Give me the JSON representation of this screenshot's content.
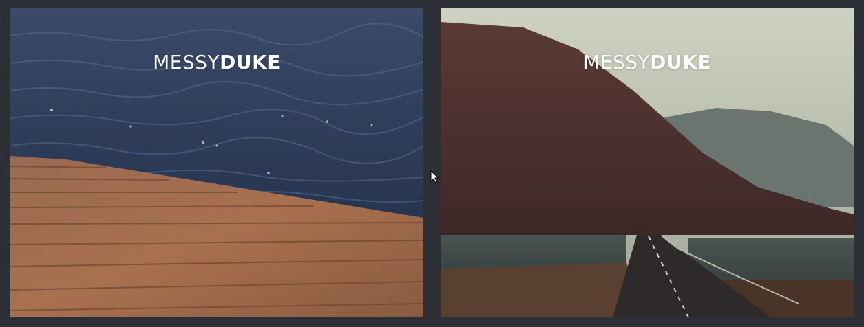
{
  "slides": [
    {
      "logo": {
        "light": "MESSY",
        "bold": "DUKE"
      },
      "scene": "water-and-wooden-dock"
    },
    {
      "logo": {
        "light": "MESSY",
        "bold": "DUKE"
      },
      "scene": "mountain-road"
    }
  ],
  "cursor_icon": "mouse-pointer-icon",
  "colors": {
    "background": "#2c2f35",
    "logo_text": "#ffffff"
  }
}
